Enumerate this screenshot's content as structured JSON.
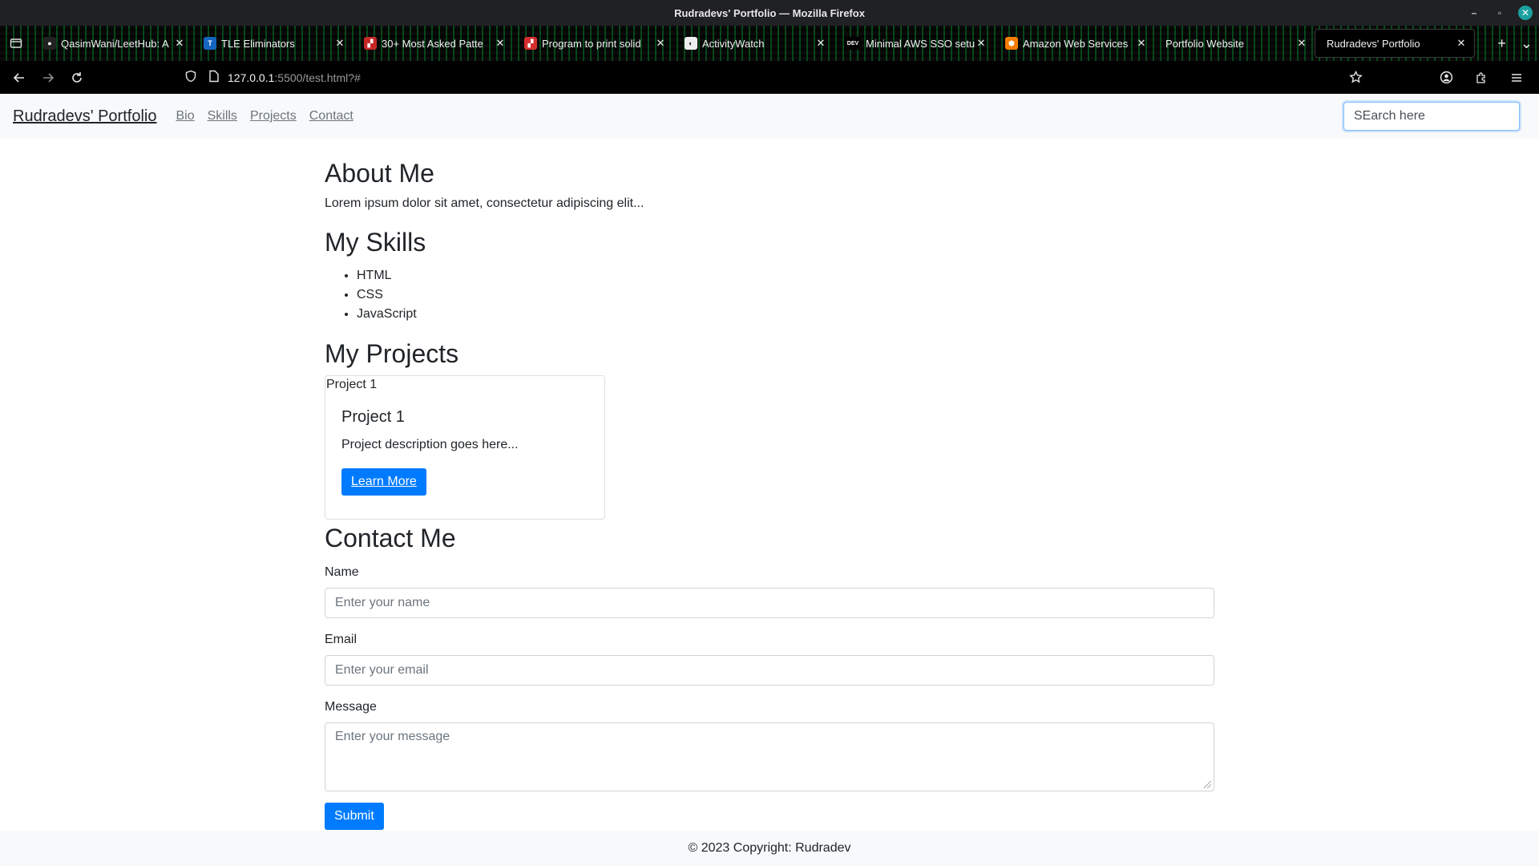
{
  "window": {
    "title": "Rudradevs' Portfolio — Mozilla Firefox",
    "controls": {
      "minimize": "–",
      "restore": "▫",
      "close": "✕"
    }
  },
  "tabs": [
    {
      "label": "QasimWani/LeetHub: A",
      "favicon": "github-icon",
      "fav_color": "#222222",
      "fav_glyph": "●",
      "close": "✕"
    },
    {
      "label": "TLE Eliminators",
      "favicon": "tle-icon",
      "fav_color": "#1565c0",
      "fav_glyph": "T",
      "close": "✕"
    },
    {
      "label": "30+ Most Asked Patte",
      "favicon": "pattern-icon",
      "fav_color": "#c62828",
      "fav_glyph": "▞",
      "close": "✕"
    },
    {
      "label": "Program to print solid",
      "favicon": "gfg-icon",
      "fav_color": "#d32f2f",
      "fav_glyph": "▞",
      "close": "✕"
    },
    {
      "label": "ActivityWatch",
      "favicon": "activitywatch-icon",
      "fav_color": "#eeeeee",
      "fav_glyph": "◐",
      "close": "✕"
    },
    {
      "label": "Minimal AWS SSO setu",
      "favicon": "dev-icon",
      "fav_color": "#000000",
      "fav_glyph": "DEV",
      "close": "✕"
    },
    {
      "label": "Amazon Web Services",
      "favicon": "aws-icon",
      "fav_color": "#f57c00",
      "fav_glyph": "⬢",
      "close": "✕"
    },
    {
      "label": "Portfolio Website",
      "favicon": "",
      "fav_color": "",
      "fav_glyph": "",
      "close": "✕"
    },
    {
      "label": "Rudradevs' Portfolio",
      "favicon": "",
      "fav_color": "",
      "fav_glyph": "",
      "close": "✕",
      "active": true
    }
  ],
  "toolbar": {
    "new_tab": "+",
    "list_tabs": "⌄",
    "url_host": "127.0.0.1",
    "url_path": ":5500/test.html?#"
  },
  "site": {
    "brand": "Rudradevs' Portfolio",
    "nav": [
      "Bio",
      "Skills",
      "Projects",
      "Contact"
    ],
    "search_value": "SEarch here"
  },
  "about": {
    "heading": "About Me",
    "text": "Lorem ipsum dolor sit amet, consectetur adipiscing elit..."
  },
  "skills": {
    "heading": "My Skills",
    "items": [
      "HTML",
      "CSS",
      "JavaScript"
    ]
  },
  "projects": {
    "heading": "My Projects",
    "card": {
      "image_alt": "Project 1",
      "title": "Project 1",
      "text": "Project description goes here...",
      "button": "Learn More"
    }
  },
  "contact": {
    "heading": "Contact Me",
    "name_label": "Name",
    "name_placeholder": "Enter your name",
    "email_label": "Email",
    "email_placeholder": "Enter your email",
    "message_label": "Message",
    "message_placeholder": "Enter your message",
    "submit": "Submit"
  },
  "footer": {
    "text": "© 2023 Copyright: Rudradev"
  },
  "colors": {
    "primary": "#007bff",
    "navbar_bg": "#f8f9fa",
    "link_muted": "#6c757d"
  }
}
